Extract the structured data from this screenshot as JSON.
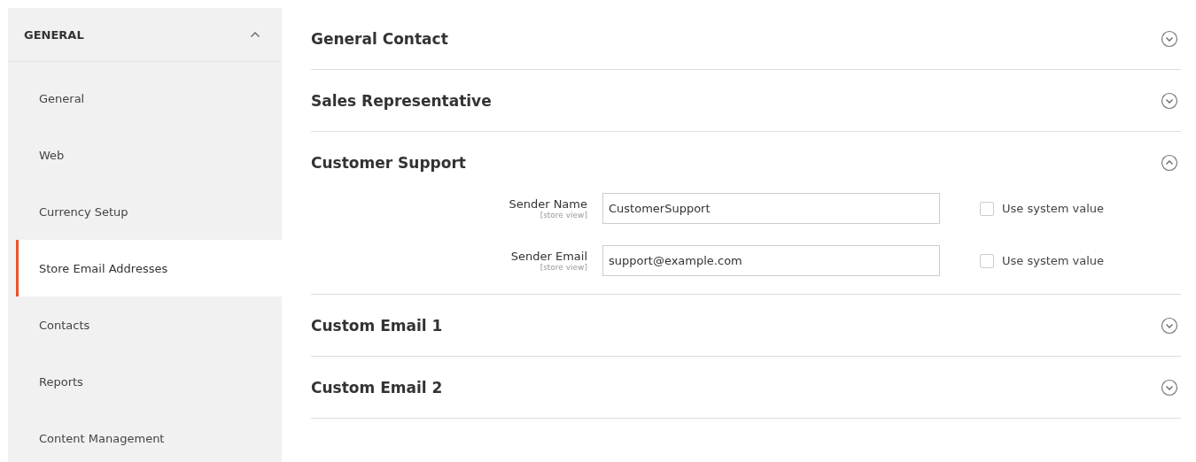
{
  "sidebar": {
    "title": "GENERAL",
    "expanded": true,
    "items": [
      {
        "label": "General",
        "selected": false
      },
      {
        "label": "Web",
        "selected": false
      },
      {
        "label": "Currency Setup",
        "selected": false
      },
      {
        "label": "Store Email Addresses",
        "selected": true
      },
      {
        "label": "Contacts",
        "selected": false
      },
      {
        "label": "Reports",
        "selected": false
      },
      {
        "label": "Content Management",
        "selected": false
      }
    ]
  },
  "sections": [
    {
      "title": "General Contact",
      "expanded": false
    },
    {
      "title": "Sales Representative",
      "expanded": false
    },
    {
      "title": "Customer Support",
      "expanded": true,
      "fields": [
        {
          "label": "Sender Name",
          "scope": "[store view]",
          "value": "CustomerSupport",
          "checkbox_label": "Use system value",
          "checked": false
        },
        {
          "label": "Sender Email",
          "scope": "[store view]",
          "value": "support@example.com",
          "checkbox_label": "Use system value",
          "checked": false
        }
      ]
    },
    {
      "title": "Custom Email 1",
      "expanded": false
    },
    {
      "title": "Custom Email 2",
      "expanded": false
    }
  ]
}
